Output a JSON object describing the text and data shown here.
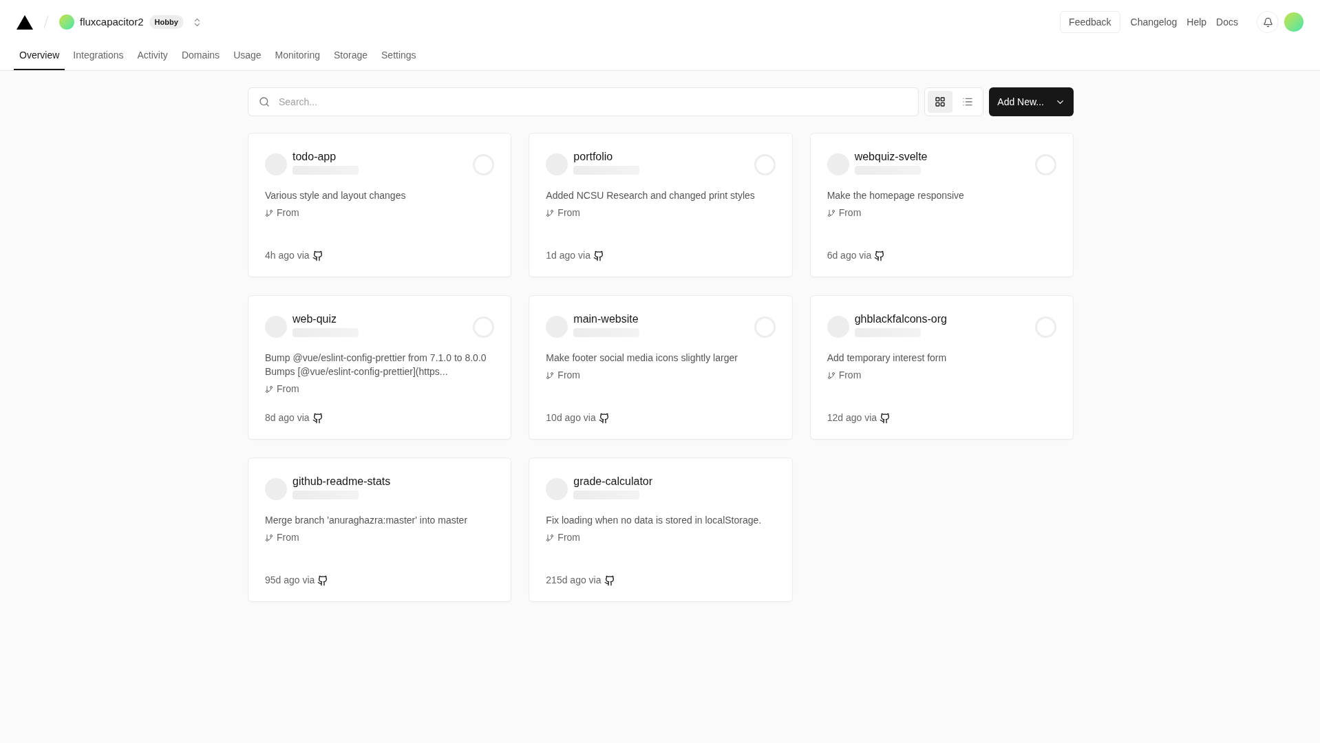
{
  "header": {
    "team": "fluxcapacitor2",
    "plan": "Hobby",
    "links": [
      {
        "label": "Feedback",
        "kind": "button"
      },
      {
        "label": "Changelog",
        "kind": "link"
      },
      {
        "label": "Help",
        "kind": "link"
      },
      {
        "label": "Docs",
        "kind": "link"
      }
    ]
  },
  "tabs": [
    {
      "label": "Overview",
      "selected": true
    },
    {
      "label": "Integrations",
      "selected": false
    },
    {
      "label": "Activity",
      "selected": false
    },
    {
      "label": "Domains",
      "selected": false
    },
    {
      "label": "Usage",
      "selected": false
    },
    {
      "label": "Monitoring",
      "selected": false
    },
    {
      "label": "Storage",
      "selected": false
    },
    {
      "label": "Settings",
      "selected": false
    }
  ],
  "search": {
    "placeholder": "Search..."
  },
  "view_toggle": [
    {
      "kind": "grid",
      "selected": true
    },
    {
      "kind": "list",
      "selected": false
    }
  ],
  "add_button": "Add New...",
  "projects": [
    {
      "name": "todo-app",
      "message": "Various style and layout changes",
      "branch": "From",
      "time": "4h ago via",
      "ring": true
    },
    {
      "name": "portfolio",
      "message": "Added NCSU Research and changed print styles",
      "branch": "From",
      "time": "1d ago via",
      "ring": true
    },
    {
      "name": "webquiz-svelte",
      "message": "Make the homepage responsive",
      "branch": "From",
      "time": "6d ago via",
      "ring": true
    },
    {
      "name": "web-quiz",
      "message": "Bump @vue/eslint-config-prettier from 7.1.0 to 8.0.0 Bumps [@vue/eslint-config-prettier](https...",
      "branch": "From",
      "time": "8d ago via",
      "ring": true
    },
    {
      "name": "main-website",
      "message": "Make footer social media icons slightly larger",
      "branch": "From",
      "time": "10d ago via",
      "ring": true
    },
    {
      "name": "ghblackfalcons-org",
      "message": "Add temporary interest form",
      "branch": "From",
      "time": "12d ago via",
      "ring": true
    },
    {
      "name": "github-readme-stats",
      "message": "Merge branch 'anuraghazra:master' into master",
      "branch": "From",
      "time": "95d ago via",
      "ring": false
    },
    {
      "name": "grade-calculator",
      "message": "Fix loading when no data is stored in localStorage.",
      "branch": "From",
      "time": "215d ago via",
      "ring": false
    }
  ]
}
